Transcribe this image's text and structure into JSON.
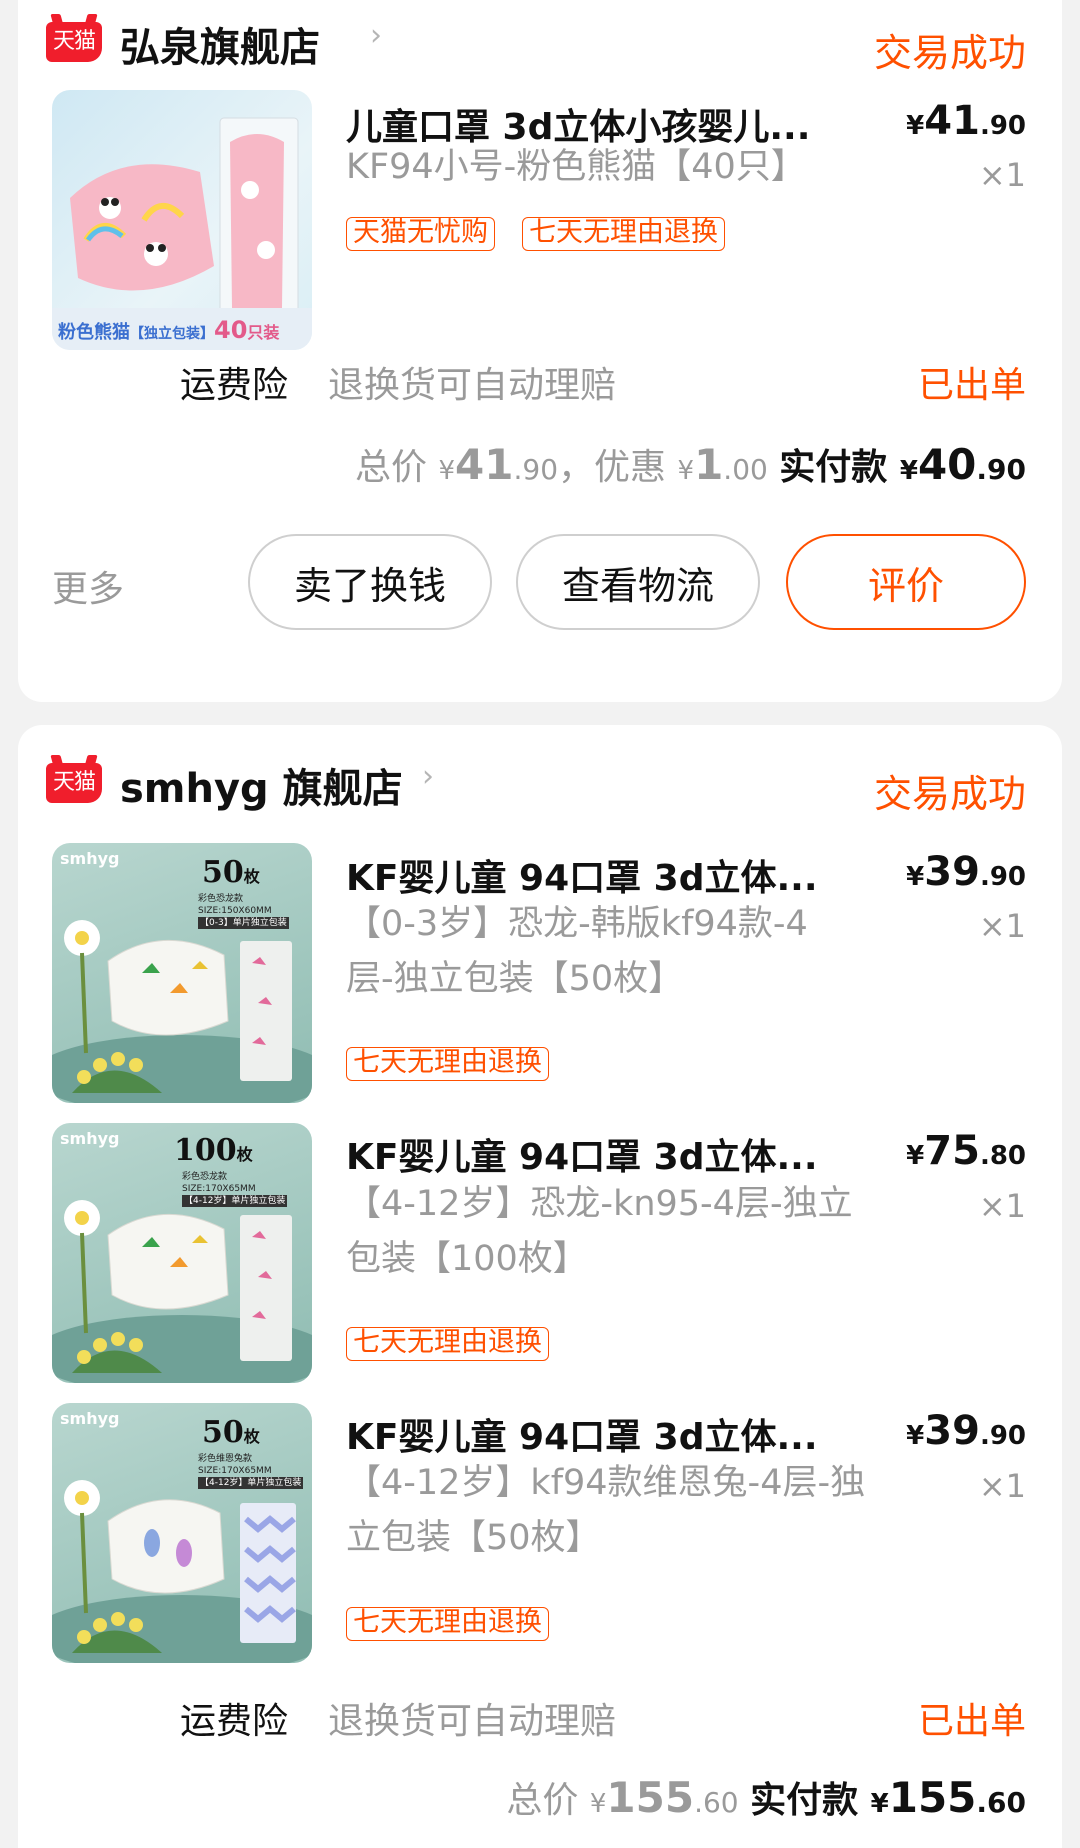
{
  "orders": [
    {
      "platform_badge": "天猫",
      "shop_name": "弘泉旗舰店",
      "status": "交易成功",
      "items": [
        {
          "title": "儿童口罩 3d立体小孩婴儿...",
          "variant": "KF94小号-粉色熊猫【40只】",
          "currency": "¥",
          "price_int": "41",
          "price_dec": ".90",
          "qty": "×1",
          "tags": [
            "天猫无忧购",
            "七天无理由退换"
          ],
          "thumb_text": {
            "label": "粉色熊猫",
            "sub": "【独立包装】",
            "count": "40",
            "unit": "只装"
          }
        }
      ],
      "insurance": {
        "label": "运费险",
        "desc": "退换货可自动理赔",
        "status": "已出单"
      },
      "summary": {
        "total_label": "总价",
        "total_int": "41",
        "total_dec": ".90",
        "separator": "，",
        "discount_label": "优惠",
        "discount_int": "1",
        "discount_dec": ".00",
        "paid_label": "实付款",
        "paid_int": "40",
        "paid_dec": ".90"
      },
      "more_label": "更多",
      "buttons": [
        "卖了换钱",
        "查看物流",
        "评价"
      ]
    },
    {
      "platform_badge": "天猫",
      "shop_name": "smhyg 旗舰店",
      "status": "交易成功",
      "items": [
        {
          "title": "KF婴儿童 94口罩 3d立体...",
          "variant": "【0-3岁】恐龙-韩版kf94款-4层-独立包装【50枚】",
          "currency": "¥",
          "price_int": "39",
          "price_dec": ".90",
          "qty": "×1",
          "tags": [
            "七天无理由退换"
          ],
          "thumb_text": {
            "brand": "smhyg",
            "count": "50",
            "unit": "枚",
            "line1": "彩色恐龙款",
            "line2": "SIZE:150X60MM",
            "line3": "【0-3】单片独立包装"
          }
        },
        {
          "title": "KF婴儿童 94口罩 3d立体...",
          "variant": "【4-12岁】恐龙-kn95-4层-独立包装【100枚】",
          "currency": "¥",
          "price_int": "75",
          "price_dec": ".80",
          "qty": "×1",
          "tags": [
            "七天无理由退换"
          ],
          "thumb_text": {
            "brand": "smhyg",
            "count": "100",
            "unit": "枚",
            "line1": "彩色恐龙款",
            "line2": "SIZE:170X65MM",
            "line3": "【4-12岁】单片独立包装"
          }
        },
        {
          "title": "KF婴儿童 94口罩 3d立体...",
          "variant": "【4-12岁】kf94款维恩兔-4层-独立包装【50枚】",
          "currency": "¥",
          "price_int": "39",
          "price_dec": ".90",
          "qty": "×1",
          "tags": [
            "七天无理由退换"
          ],
          "thumb_text": {
            "brand": "smhyg",
            "count": "50",
            "unit": "枚",
            "line1": "彩色维恩兔款",
            "line2": "SIZE:170X65MM",
            "line3": "【4-12岁】单片独立包装"
          }
        }
      ],
      "insurance": {
        "label": "运费险",
        "desc": "退换货可自动理赔",
        "status": "已出单"
      },
      "summary": {
        "total_label": "总价",
        "total_int": "155",
        "total_dec": ".60",
        "paid_label": "实付款",
        "paid_int": "155",
        "paid_dec": ".60"
      }
    }
  ],
  "colors": {
    "accent": "#ff5000",
    "tmall_red": "#f01e2c",
    "muted": "#9a9a9a",
    "background": "#f2f2f2"
  }
}
